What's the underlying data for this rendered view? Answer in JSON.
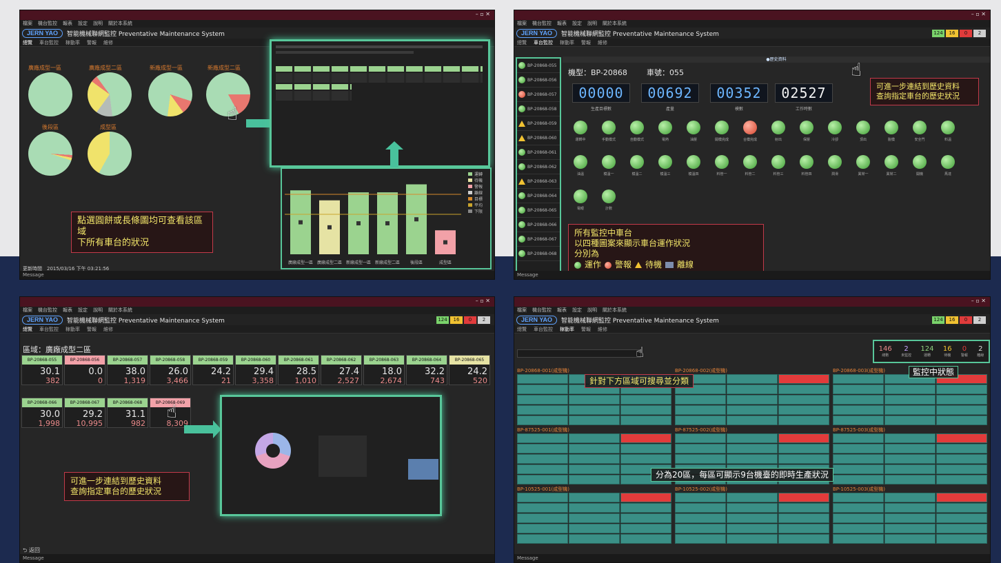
{
  "window": {
    "menu": [
      "檔案",
      "機台監控",
      "報表",
      "設定",
      "說明",
      "關於本系統"
    ],
    "logo": "JERN YAO",
    "title": "智能機械聯網監控 Preventative Maintenance System",
    "tabs": [
      "總覽",
      "車台監控",
      "稼動率",
      "警報",
      "維修"
    ],
    "status_counts": [
      "124",
      "16",
      "0",
      "2"
    ],
    "status_colors": [
      "#7ad36b",
      "#f1c232",
      "#e03b3b",
      "#cfcfcf"
    ]
  },
  "panel1": {
    "pie_labels": [
      "廣廠成型一區",
      "廣廠成型二區",
      "新廠成型一區",
      "新廠成型二區",
      "後段區",
      "成型區"
    ],
    "callout": [
      "點選圓餅或長條圖均可查看該區域",
      "下所有車台的狀況"
    ],
    "footer": "更新時間　2015/03/16 下午 03:21:56",
    "footbar": "Message",
    "bars": [
      {
        "label": "廣廠成型一區",
        "value": 32,
        "color": "#9bd38f"
      },
      {
        "label": "廣廠成型二區",
        "value": 27,
        "color": "#e6e3a4"
      },
      {
        "label": "新廠成型一區",
        "value": 31,
        "color": "#9bd38f"
      },
      {
        "label": "新廠成型二區",
        "value": 31,
        "color": "#9bd38f"
      },
      {
        "label": "後段區",
        "value": 35,
        "color": "#9bd38f"
      },
      {
        "label": "成型區",
        "value": 12,
        "color": "#f2a1a8"
      }
    ],
    "legend": [
      "運轉",
      "待機",
      "警報",
      "離線",
      "目標",
      "平均",
      "下限"
    ]
  },
  "panel2": {
    "section": "●歷史資料",
    "model": "機型：BP-20868",
    "machine": "車號：055",
    "counters": [
      {
        "value": "00000",
        "label": "生產目標數"
      },
      {
        "value": "00692",
        "label": "產量"
      },
      {
        "value": "00352",
        "label": "模數"
      },
      {
        "value": "02527",
        "label": "工作時數"
      }
    ],
    "callout_top": [
      "可進一步連結到歷史資料",
      "查詢指定車台的歷史狀況"
    ],
    "callout_bottom": [
      "所有監控中車台",
      "以四種圖案來顯示車台運作狀況",
      "分別為"
    ],
    "legend": [
      "運作",
      "警報",
      "待機",
      "離線"
    ],
    "lamp_labels": [
      "運轉中",
      "手動模式",
      "自動模式",
      "電熱",
      "油壓",
      "開模完成",
      "合模完成",
      "射出",
      "保壓",
      "冷卻",
      "頂出",
      "脫模",
      "安全門",
      "料溫",
      "油溫",
      "模溫一",
      "模溫二",
      "模溫三",
      "模溫四",
      "料管一",
      "料管二",
      "料管三",
      "料管四",
      "潤滑",
      "異常一",
      "異常二",
      "開機",
      "馬達",
      "電眼",
      "計數"
    ],
    "machines": [
      "BP-20868-055",
      "BP-20868-056",
      "BP-20868-057",
      "BP-20868-058",
      "BP-20868-059",
      "BP-20868-060",
      "BP-20868-061",
      "BP-20868-062",
      "BP-20868-063",
      "BP-20868-064",
      "BP-20868-065",
      "BP-20868-066",
      "BP-20868-067",
      "BP-20868-068"
    ]
  },
  "panel3": {
    "area": "區域：廣廠成型二區",
    "callout": [
      "可進一步連結到歷史資料",
      "查詢指定車台的歷史狀況"
    ],
    "footer": "返回",
    "cards": [
      {
        "name": "BP-20868-055",
        "v1": "30.1",
        "v2": "382",
        "color": "#9bd38f"
      },
      {
        "name": "BP-20868-056",
        "v1": "0.0",
        "v2": "0",
        "color": "#f2a1a8"
      },
      {
        "name": "BP-20868-057",
        "v1": "38.0",
        "v2": "1,319",
        "color": "#9bd38f"
      },
      {
        "name": "BP-20868-058",
        "v1": "26.0",
        "v2": "3,466",
        "color": "#9bd38f"
      },
      {
        "name": "BP-20868-059",
        "v1": "24.2",
        "v2": "21",
        "color": "#9bd38f"
      },
      {
        "name": "BP-20868-060",
        "v1": "29.4",
        "v2": "3,358",
        "color": "#9bd38f"
      },
      {
        "name": "BP-20868-061",
        "v1": "28.5",
        "v2": "1,010",
        "color": "#9bd38f"
      },
      {
        "name": "BP-20868-062",
        "v1": "27.4",
        "v2": "2,527",
        "color": "#9bd38f"
      },
      {
        "name": "BP-20868-063",
        "v1": "18.0",
        "v2": "2,674",
        "color": "#9bd38f"
      },
      {
        "name": "BP-20868-064",
        "v1": "32.2",
        "v2": "743",
        "color": "#9bd38f"
      },
      {
        "name": "BP-20868-065",
        "v1": "24.2",
        "v2": "520",
        "color": "#e6e3a4"
      },
      {
        "name": "BP-20868-066",
        "v1": "30.0",
        "v2": "1,998",
        "color": "#9bd38f"
      },
      {
        "name": "BP-20868-067",
        "v1": "29.2",
        "v2": "10,995",
        "color": "#9bd38f"
      },
      {
        "name": "BP-20868-068",
        "v1": "31.1",
        "v2": "982",
        "color": "#9bd38f"
      },
      {
        "name": "BP-20868-069",
        "v1": "",
        "v2": "8,309",
        "color": "#f2a1a8"
      }
    ]
  },
  "panel4": {
    "counts": [
      "146",
      "2",
      "124",
      "16",
      "0",
      "2"
    ],
    "count_labels": [
      "總數",
      "未監控",
      "運轉",
      "待機",
      "警報",
      "離線"
    ],
    "callout_top": "針對下方區域可搜尋並分類",
    "callout_right": "監控中狀態",
    "callout_mid": "分為20區，每區可顯示9台機臺的即時生產狀況",
    "group_titles": [
      "BP-20868-001(成型機)",
      "BP-20868-002(成型機)",
      "BP-20868-003(成型機)",
      "BP-87525-001(成型機)",
      "BP-87525-002(成型機)",
      "BP-87525-003(成型機)",
      "BP-10525-001(成型機)",
      "BP-10525-002(成型機)",
      "BP-10525-003(成型機)"
    ]
  }
}
